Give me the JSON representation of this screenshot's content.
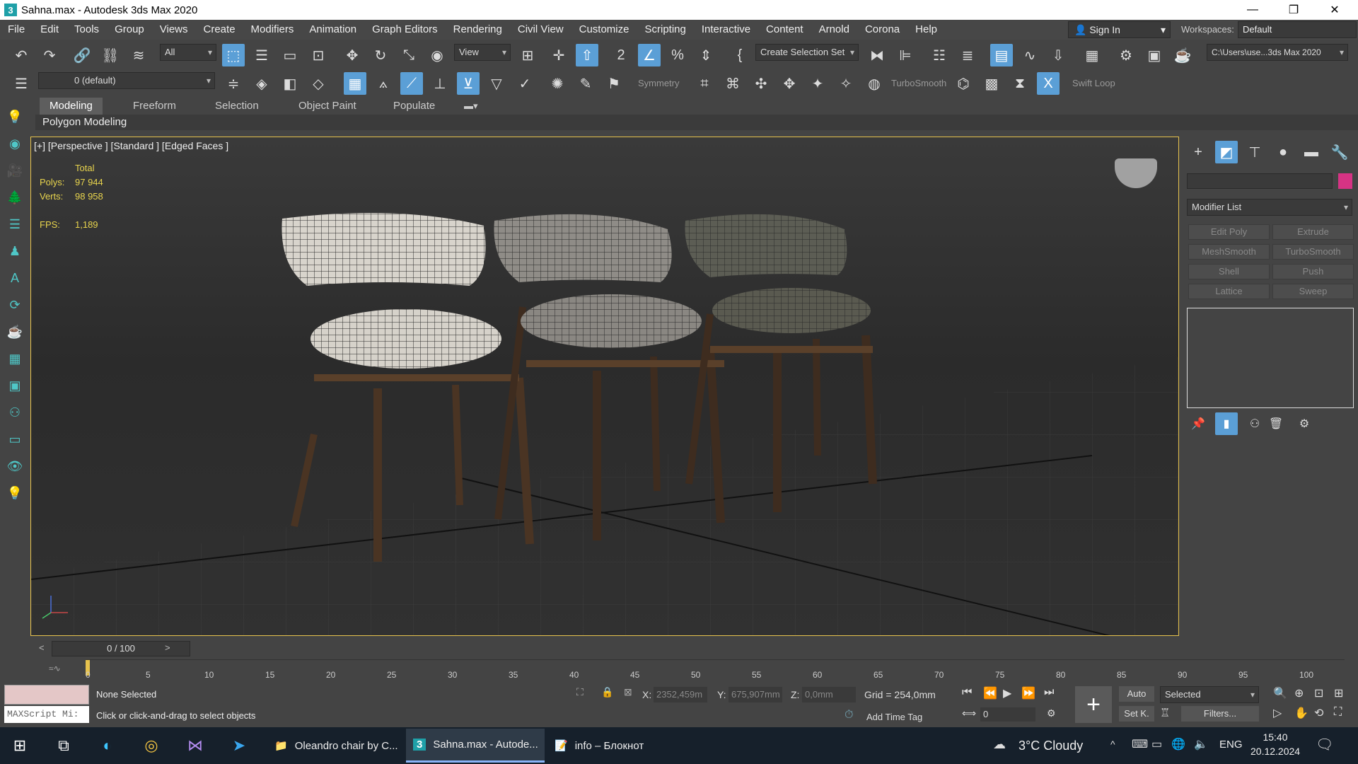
{
  "titlebar": {
    "title": "Sahna.max - Autodesk 3ds Max 2020",
    "logo": "3"
  },
  "menu": [
    "File",
    "Edit",
    "Tools",
    "Group",
    "Views",
    "Create",
    "Modifiers",
    "Animation",
    "Graph Editors",
    "Rendering",
    "Civil View",
    "Customize",
    "Scripting",
    "Interactive",
    "Content",
    "Arnold",
    "Corona",
    "Help"
  ],
  "account": {
    "signin": "Sign In",
    "workspaces_label": "Workspaces:",
    "workspace": "Default"
  },
  "toolbar": {
    "filter": "All",
    "ref_coord": "View",
    "selection_set": "Create Selection Set",
    "project_path": "C:\\Users\\use...3ds Max 2020",
    "layer": "0 (default)",
    "symmetry": "Symmetry",
    "turbosmooth": "TurboSmooth",
    "swiftloop": "Swift Loop"
  },
  "ribbon": {
    "tabs": [
      "Modeling",
      "Freeform",
      "Selection",
      "Object Paint",
      "Populate"
    ],
    "active": "Modeling",
    "panel": "Polygon Modeling"
  },
  "viewport": {
    "label": "[+] [Perspective ] [Standard ] [Edged Faces ]",
    "stats": {
      "total_label": "Total",
      "polys_label": "Polys:",
      "polys": "97 944",
      "verts_label": "Verts:",
      "verts": "98 958",
      "fps_label": "FPS:",
      "fps": "1,189"
    }
  },
  "command_panel": {
    "color": "#d63384",
    "modifier_list": "Modifier List",
    "buttons": [
      "Edit Poly",
      "Extrude",
      "MeshSmooth",
      "TurboSmooth",
      "Shell",
      "Push",
      "Lattice",
      "Sweep"
    ]
  },
  "timeline": {
    "frame": "0 / 100",
    "ticks": [
      "0",
      "5",
      "10",
      "15",
      "20",
      "25",
      "30",
      "35",
      "40",
      "45",
      "50",
      "55",
      "60",
      "65",
      "70",
      "75",
      "80",
      "85",
      "90",
      "95",
      "100"
    ]
  },
  "status": {
    "maxscript": "MAXScript Mi:",
    "selection": "None Selected",
    "prompt": "Click or click-and-drag to select objects",
    "x_label": "X:",
    "x": "2352,459m",
    "y_label": "Y:",
    "y": "675,907mm",
    "z_label": "Z:",
    "z": "0,0mm",
    "grid": "Grid = 254,0mm",
    "add_time_tag": "Add Time Tag",
    "auto": "Auto",
    "setk": "Set K.",
    "selected": "Selected",
    "filters": "Filters...",
    "frame_field": "0"
  },
  "taskbar": {
    "apps": [
      "Oleandro chair by C...",
      "Sahna.max - Autode...",
      "info – Блокнот"
    ],
    "weather": "3°C  Cloudy",
    "lang": "ENG",
    "time": "15:40",
    "date": "20.12.2024"
  }
}
